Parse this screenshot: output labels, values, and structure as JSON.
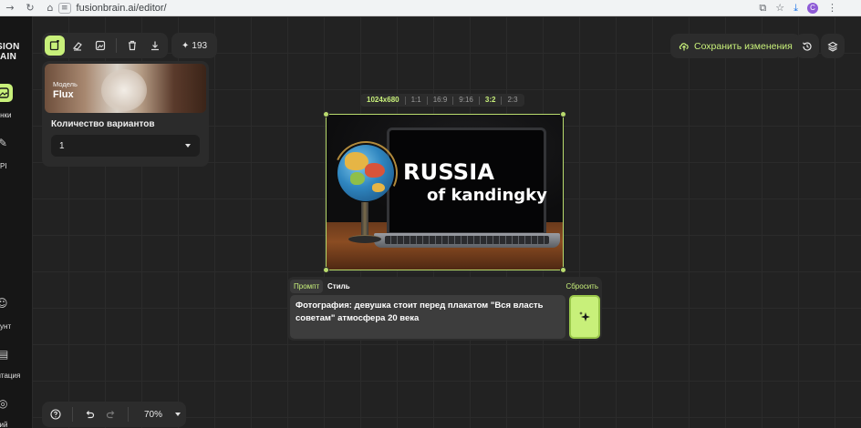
{
  "browser": {
    "url": "fusionbrain.ai/editor/",
    "profile_initial": "C"
  },
  "nav": {
    "logo_line1": "SION",
    "logo_line2": "AIN",
    "item_images": "тинки",
    "item_api": "PI",
    "item_account": "каунт",
    "item_docs": "ентация",
    "item_lang": "ский"
  },
  "toolbar": {
    "credits": "193",
    "save_label": "Сохранить изменения"
  },
  "model_panel": {
    "model_caption": "Модель",
    "model_name": "Flux",
    "variants_label": "Количество вариантов",
    "variants_value": "1"
  },
  "ratios": {
    "size": "1024x680",
    "options": [
      "1:1",
      "16:9",
      "9:16",
      "3:2",
      "2:3"
    ],
    "selected": "3:2"
  },
  "image": {
    "line1": "RUSSIA",
    "line2": "of kandingky"
  },
  "prompt": {
    "tab_prompt": "Промпт",
    "tab_style": "Стиль",
    "reset": "Сбросить",
    "text": "Фотография: девушка стоит перед плакатом \"Вся власть советам\" атмосфера 20 века"
  },
  "zoom": {
    "value": "70%"
  },
  "colors": {
    "accent": "#c8f07a",
    "background": "#222222",
    "panel": "#2c2c2c"
  }
}
